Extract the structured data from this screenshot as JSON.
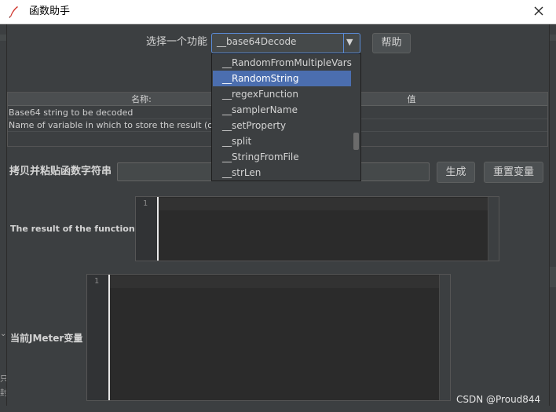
{
  "window": {
    "title": "函数助手",
    "close_glyph": "✕",
    "icon": "feather-icon"
  },
  "selector": {
    "label": "选择一个功能",
    "value": "__base64Decode",
    "arrow": "▼",
    "help_label": "帮助"
  },
  "dropdown": {
    "items": [
      "__RandomFromMultipleVars",
      "__RandomString",
      "__regexFunction",
      "__samplerName",
      "__setProperty",
      "__split",
      "__StringFromFile",
      "__strLen"
    ],
    "selected_index": 1
  },
  "param_table": {
    "headers": [
      "名称:",
      "值"
    ],
    "rows": [
      [
        "Base64 string to be decoded",
        ""
      ],
      [
        "Name of variable in which to store the result (op",
        ""
      ]
    ]
  },
  "copy_row": {
    "label": "拷贝并粘贴函数字符串",
    "input_value": "",
    "generate_label": "生成",
    "reset_label": "重置变量"
  },
  "result": {
    "label": "The result of the function is",
    "line_number": "1"
  },
  "variables": {
    "label": "当前JMeter变量",
    "line_number": "1"
  },
  "background": {
    "fragment_text_1": "只行",
    "fragment_text_2": "封"
  },
  "watermark": "CSDN @Proud844",
  "colors": {
    "background": "#3c3f41",
    "selection": "#4b6eaf",
    "focus_border": "#5a8bd6",
    "title_icon": "#d0342c"
  }
}
